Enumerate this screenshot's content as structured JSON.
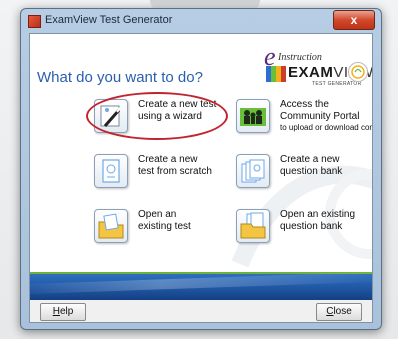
{
  "window": {
    "title": "ExamView Test Generator",
    "close_glyph": "x"
  },
  "headline": "What do you want to do?",
  "logo": {
    "e": "e",
    "instruction": "Instruction",
    "examview": "EXAM",
    "view": "VIEW",
    "tagline": "TEST GENERATOR"
  },
  "options": [
    {
      "id": "create-wizard",
      "lines": [
        "Create a new test",
        "using a wizard"
      ],
      "icon": "magic-wand-icon"
    },
    {
      "id": "community-portal",
      "lines": [
        "Access the",
        "Community Portal"
      ],
      "sub": "to upload or download content",
      "icon": "people-icon"
    },
    {
      "id": "create-scratch",
      "lines": [
        "Create a new",
        "test from scratch"
      ],
      "icon": "new-test-icon"
    },
    {
      "id": "create-bank",
      "lines": [
        "Create a new",
        "question bank"
      ],
      "icon": "new-bank-icon"
    },
    {
      "id": "open-test",
      "lines": [
        "Open an",
        "existing test"
      ],
      "icon": "open-test-icon"
    },
    {
      "id": "open-bank",
      "lines": [
        "Open an existing",
        "question bank"
      ],
      "icon": "open-bank-icon"
    }
  ],
  "footer": {
    "help_first": "H",
    "help_rest": "elp",
    "close_first": "C",
    "close_rest": "lose"
  },
  "colors": {
    "accent": "#2a5fb0",
    "band": "#1f56a3",
    "highlight": "#c2242f"
  }
}
